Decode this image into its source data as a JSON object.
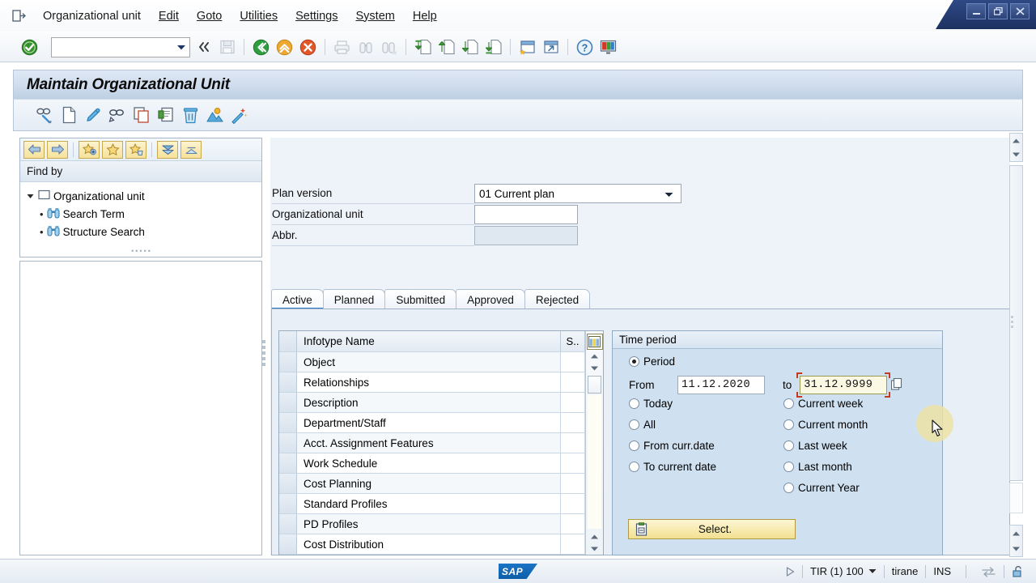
{
  "window": {
    "controls": [
      {
        "name": "minimize",
        "glyph": "minimize-icon"
      },
      {
        "name": "restore",
        "glyph": "restore-icon"
      },
      {
        "name": "close",
        "glyph": "close-icon"
      }
    ]
  },
  "menubar": {
    "system_icon": "sap-system-menu-icon",
    "items": [
      {
        "label": "Organizational unit",
        "accel": ""
      },
      {
        "label": "Edit",
        "accel": "E"
      },
      {
        "label": "Goto",
        "accel": "G"
      },
      {
        "label": "Utilities",
        "accel": "U"
      },
      {
        "label": "Settings",
        "accel": "S"
      },
      {
        "label": "System",
        "accel": "y"
      },
      {
        "label": "Help",
        "accel": "H"
      }
    ]
  },
  "toolbar": {
    "enter_icon": "green-check-enter-icon",
    "command_field": {
      "value": "",
      "placeholder": ""
    },
    "collapse_icon": "double-chevron-left-icon",
    "icons": [
      {
        "name": "save-icon",
        "enabled": false
      },
      {
        "name": "back-icon",
        "enabled": true
      },
      {
        "name": "exit-icon",
        "enabled": true
      },
      {
        "name": "cancel-icon",
        "enabled": true
      },
      {
        "name": "print-icon",
        "enabled": false
      },
      {
        "name": "find-icon",
        "enabled": false
      },
      {
        "name": "find-next-icon",
        "enabled": false
      },
      {
        "name": "first-page-icon",
        "enabled": true
      },
      {
        "name": "previous-page-icon",
        "enabled": true
      },
      {
        "name": "next-page-icon",
        "enabled": true
      },
      {
        "name": "last-page-icon",
        "enabled": true
      },
      {
        "name": "create-session-icon",
        "enabled": true
      },
      {
        "name": "create-shortcut-icon",
        "enabled": true
      },
      {
        "name": "help-icon",
        "enabled": true
      },
      {
        "name": "customize-layout-icon",
        "enabled": true
      }
    ]
  },
  "title": "Maintain Organizational Unit",
  "appbar": {
    "icons": [
      {
        "name": "display-icon"
      },
      {
        "name": "create-icon"
      },
      {
        "name": "change-icon"
      },
      {
        "name": "display-relationships-icon"
      },
      {
        "name": "copy-icon"
      },
      {
        "name": "delimit-icon"
      },
      {
        "name": "delete-icon"
      },
      {
        "name": "organizational-structure-icon"
      },
      {
        "name": "magic-wand-icon"
      }
    ]
  },
  "sidebar": {
    "toolbar_buttons": [
      {
        "name": "back-arrow-button",
        "glyph": "arrow-left-icon"
      },
      {
        "name": "forward-arrow-button",
        "glyph": "arrow-right-icon"
      },
      {
        "name": "add-favorite-button",
        "glyph": "star-plus-icon"
      },
      {
        "name": "favorite-button",
        "glyph": "star-icon"
      },
      {
        "name": "delete-favorite-button",
        "glyph": "star-delete-icon"
      },
      {
        "name": "collapse-all-button",
        "glyph": "collapse-down-icon"
      },
      {
        "name": "expand-all-button",
        "glyph": "expand-up-icon"
      }
    ],
    "find_by_label": "Find by",
    "tree": {
      "root": {
        "label": "Organizational unit",
        "expanded": true,
        "icon": "checkbox-node-icon"
      },
      "children": [
        {
          "label": "Search Term",
          "icon": "binoculars-icon"
        },
        {
          "label": "Structure Search",
          "icon": "binoculars-icon"
        }
      ]
    }
  },
  "form": {
    "plan_version": {
      "label": "Plan version",
      "value": "01 Current plan",
      "dropdown_icon": "chevron-down-icon"
    },
    "org_unit": {
      "label": "Organizational unit",
      "value": "",
      "enabled": true
    },
    "abbr": {
      "label": "Abbr.",
      "value": "",
      "enabled": false
    }
  },
  "tabs": [
    {
      "label": "Active",
      "active": true
    },
    {
      "label": "Planned",
      "active": false
    },
    {
      "label": "Submitted",
      "active": false
    },
    {
      "label": "Approved",
      "active": false
    },
    {
      "label": "Rejected",
      "active": false
    }
  ],
  "infotype_table": {
    "columns": [
      "Infotype Name",
      "S.."
    ],
    "config_icon": "table-settings-icon",
    "rows": [
      {
        "name": "Object",
        "s": ""
      },
      {
        "name": "Relationships",
        "s": ""
      },
      {
        "name": "Description",
        "s": ""
      },
      {
        "name": "Department/Staff",
        "s": ""
      },
      {
        "name": "Acct. Assignment Features",
        "s": ""
      },
      {
        "name": "Work Schedule",
        "s": ""
      },
      {
        "name": "Cost Planning",
        "s": ""
      },
      {
        "name": "Standard Profiles",
        "s": ""
      },
      {
        "name": "PD Profiles",
        "s": ""
      },
      {
        "name": "Cost Distribution",
        "s": ""
      }
    ]
  },
  "time_period": {
    "title": "Time period",
    "period_option": {
      "label": "Period",
      "selected": true
    },
    "from_label": "From",
    "from_value": "11.12.2020",
    "to_label": "to",
    "to_value": "31.12.9999",
    "to_focused": true,
    "value_help_icon": "value-help-icon",
    "options_left": [
      {
        "label": "Today",
        "selected": false
      },
      {
        "label": "All",
        "selected": false
      },
      {
        "label": "From curr.date",
        "selected": false
      },
      {
        "label": "To current date",
        "selected": false
      }
    ],
    "options_right": [
      {
        "label": "Current week",
        "selected": false
      },
      {
        "label": "Current month",
        "selected": false
      },
      {
        "label": "Last week",
        "selected": false
      },
      {
        "label": "Last month",
        "selected": false
      },
      {
        "label": "Current Year",
        "selected": false
      }
    ],
    "select_button": {
      "label": "Select.",
      "icon": "select-clipboard-icon"
    }
  },
  "statusbar": {
    "logo": "SAP",
    "play_icon": "servertime-play-icon",
    "system": "TIR (1) 100",
    "system_dropdown_icon": "chevron-down-icon",
    "server": "tirane",
    "insert_mode": "INS",
    "data_icon": "data-transfer-icon",
    "lock_icon": "unlocked-icon"
  },
  "colors": {
    "accent_blue": "#2f7fd1",
    "title_band": "#cfdced",
    "panel_blue": "#cfe0f0",
    "focus_red": "#c23b22",
    "button_yellow": "#f2e08f"
  }
}
